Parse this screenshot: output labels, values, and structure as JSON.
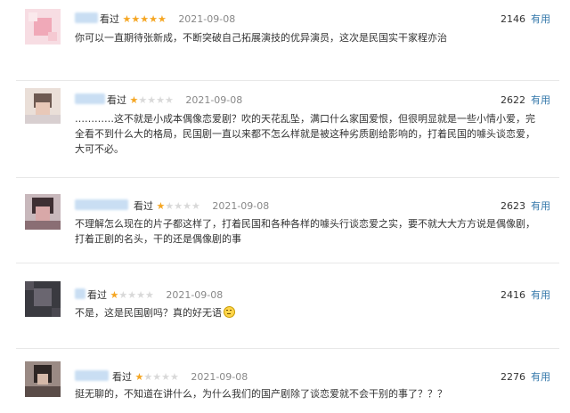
{
  "reviews": [
    {
      "seen": "看过",
      "stars": 5,
      "date": "2021-09-08",
      "votes": "2146",
      "useful": "有用",
      "content": "你可以一直期待张新成，不断突破自己拓展演技的优异演员，这次是民国实干家程亦治"
    },
    {
      "seen": "看过",
      "stars": 1,
      "date": "2021-09-08",
      "votes": "2622",
      "useful": "有用",
      "content": "…………这不就是小成本偶像恋爱剧？吹的天花乱坠，满口什么家国爱恨，但很明显就是一些小情小爱，完全看不到什么大的格局，民国剧一直以来都不怎么样就是被这种劣质剧给影响的，打着民国的噱头谈恋爱，大可不必。"
    },
    {
      "seen": "看过",
      "stars": 1,
      "date": "2021-09-08",
      "votes": "2623",
      "useful": "有用",
      "content": "不理解怎么现在的片子都这样了，打着民国和各种各样的噱头行谈恋爱之实，要不就大大方方说是偶像剧，打着正剧的名头，干的还是偶像剧的事"
    },
    {
      "seen": "看过",
      "stars": 1,
      "date": "2021-09-08",
      "votes": "2416",
      "useful": "有用",
      "content": "不是，这是民国剧吗？真的好无语"
    },
    {
      "seen": "看过",
      "stars": 1,
      "date": "2021-09-08",
      "votes": "2276",
      "useful": "有用",
      "content": "挺无聊的，不知道在讲什么，为什么我们的国产剧除了谈恋爱就不会干别的事了？？？"
    }
  ],
  "colors": {
    "star_on": "#f5a623",
    "star_off": "#d9d9d9",
    "useful_link": "#3377aa"
  },
  "icons": {
    "emoji": "speechless-face-emoji"
  }
}
